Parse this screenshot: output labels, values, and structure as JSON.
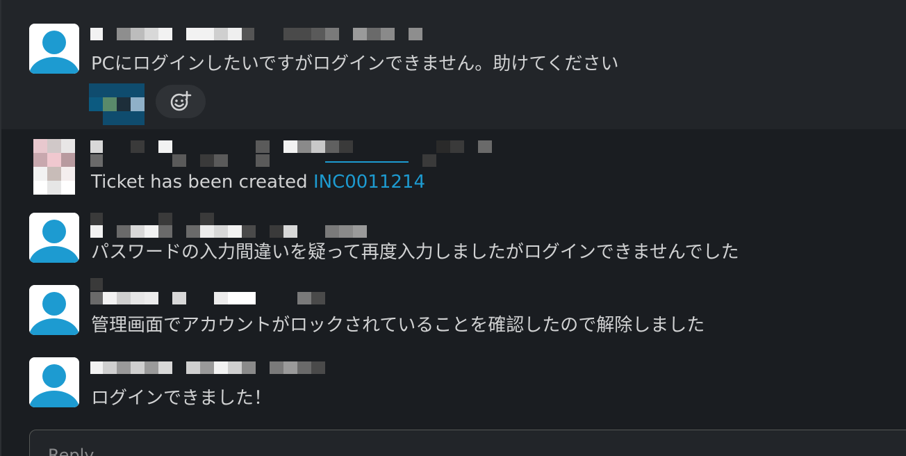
{
  "messages": [
    {
      "text": "PCにログインしたいですがログインできません。助けてください"
    },
    {
      "text_prefix": "Ticket has been created ",
      "ticket_link": "INC0011214"
    },
    {
      "text": "パスワードの入力間違いを疑って再度入力しましたがログインできませんでした"
    },
    {
      "text": "管理画面でアカウントがロックされていることを確認したので解除しました"
    },
    {
      "text": "ログインできました！"
    }
  ],
  "reply": {
    "placeholder": "Reply…"
  },
  "colors": {
    "background": "#1a1d21",
    "highlight": "#222529",
    "text": "#d1d2d3",
    "link": "#1d9bd1",
    "avatar_blue": "#1d9bd1"
  },
  "icons": {
    "avatar": "default-user-avatar-icon",
    "add_reaction": "add-reaction-emoji-icon"
  }
}
